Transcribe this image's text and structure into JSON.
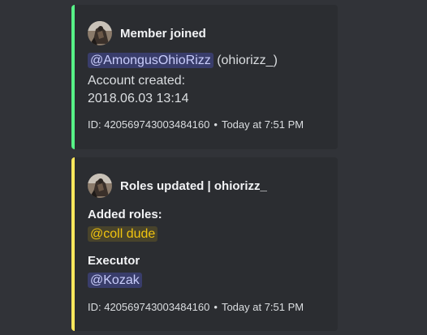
{
  "colors": {
    "join_accent": "#57f287",
    "roles_accent": "#fee75c"
  },
  "embeds": [
    {
      "author": "Member joined",
      "avatar_icon": "user-avatar",
      "mention": "@AmongusOhioRizz",
      "username": "(ohiorizz_)",
      "account_created_label": "Account created:",
      "account_created_value": "2018.06.03 13:14",
      "footer_id": "ID: 420569743003484160",
      "footer_separator": "•",
      "footer_time": "Today at 7:51 PM"
    },
    {
      "author": "Roles updated | ohiorizz_",
      "avatar_icon": "user-avatar",
      "added_roles_label": "Added roles:",
      "added_role": "@coll dude",
      "executor_label": "Executor",
      "executor": "@Kozak",
      "footer_id": "ID: 420569743003484160",
      "footer_separator": "•",
      "footer_time": "Today at 7:51 PM"
    }
  ]
}
